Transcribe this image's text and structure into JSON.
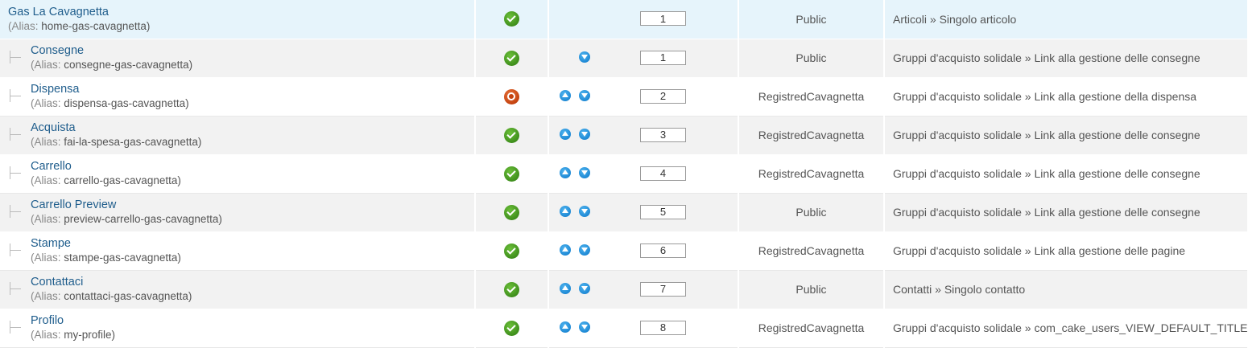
{
  "alias_label": "(Alias:",
  "colors": {
    "link": "#1f5d8c",
    "highlight_row": "#e6f4fb",
    "even_row": "#f2f2f2",
    "published": "#3f8f1c",
    "unpublished": "#c4420f",
    "arrow": "#1b86d3"
  },
  "rows": [
    {
      "title": "Gas La Cavagnetta",
      "alias": "home-gas-cavagnetta)",
      "status": "published",
      "status_icon": "check-circle-icon",
      "up": false,
      "down": false,
      "order": "1",
      "access": "Public",
      "type": "Articoli » Singolo articolo",
      "child": false,
      "highlight": true
    },
    {
      "title": "Consegne",
      "alias": "consegne-gas-cavagnetta)",
      "status": "published",
      "status_icon": "check-circle-icon",
      "up": false,
      "down": true,
      "order": "1",
      "access": "Public",
      "type": "Gruppi d'acquisto solidale » Link alla gestione delle consegne",
      "child": true,
      "highlight": false
    },
    {
      "title": "Dispensa",
      "alias": "dispensa-gas-cavagnetta)",
      "status": "unpublished",
      "status_icon": "unpublished-circle-icon",
      "up": true,
      "down": true,
      "order": "2",
      "access": "RegistredCavagnetta",
      "type": "Gruppi d'acquisto solidale » Link alla gestione della dispensa",
      "child": true,
      "highlight": false
    },
    {
      "title": "Acquista",
      "alias": "fai-la-spesa-gas-cavagnetta)",
      "status": "published",
      "status_icon": "check-circle-icon",
      "up": true,
      "down": true,
      "order": "3",
      "access": "RegistredCavagnetta",
      "type": "Gruppi d'acquisto solidale » Link alla gestione delle consegne",
      "child": true,
      "highlight": false
    },
    {
      "title": "Carrello",
      "alias": "carrello-gas-cavagnetta)",
      "status": "published",
      "status_icon": "check-circle-icon",
      "up": true,
      "down": true,
      "order": "4",
      "access": "RegistredCavagnetta",
      "type": "Gruppi d'acquisto solidale » Link alla gestione delle consegne",
      "child": true,
      "highlight": false
    },
    {
      "title": "Carrello Preview",
      "alias": "preview-carrello-gas-cavagnetta)",
      "status": "published",
      "status_icon": "check-circle-icon",
      "up": true,
      "down": true,
      "order": "5",
      "access": "Public",
      "type": "Gruppi d'acquisto solidale » Link alla gestione delle consegne",
      "child": true,
      "highlight": false
    },
    {
      "title": "Stampe",
      "alias": "stampe-gas-cavagnetta)",
      "status": "published",
      "status_icon": "check-circle-icon",
      "up": true,
      "down": true,
      "order": "6",
      "access": "RegistredCavagnetta",
      "type": "Gruppi d'acquisto solidale » Link alla gestione delle pagine",
      "child": true,
      "highlight": false
    },
    {
      "title": "Contattaci",
      "alias": "contattaci-gas-cavagnetta)",
      "status": "published",
      "status_icon": "check-circle-icon",
      "up": true,
      "down": true,
      "order": "7",
      "access": "Public",
      "type": "Contatti » Singolo contatto",
      "child": true,
      "highlight": false
    },
    {
      "title": "Profilo",
      "alias": "my-profile)",
      "status": "published",
      "status_icon": "check-circle-icon",
      "up": true,
      "down": true,
      "order": "8",
      "access": "RegistredCavagnetta",
      "type": "Gruppi d'acquisto solidale » com_cake_users_VIEW_DEFAULT_TITLE",
      "child": true,
      "highlight": false
    }
  ]
}
